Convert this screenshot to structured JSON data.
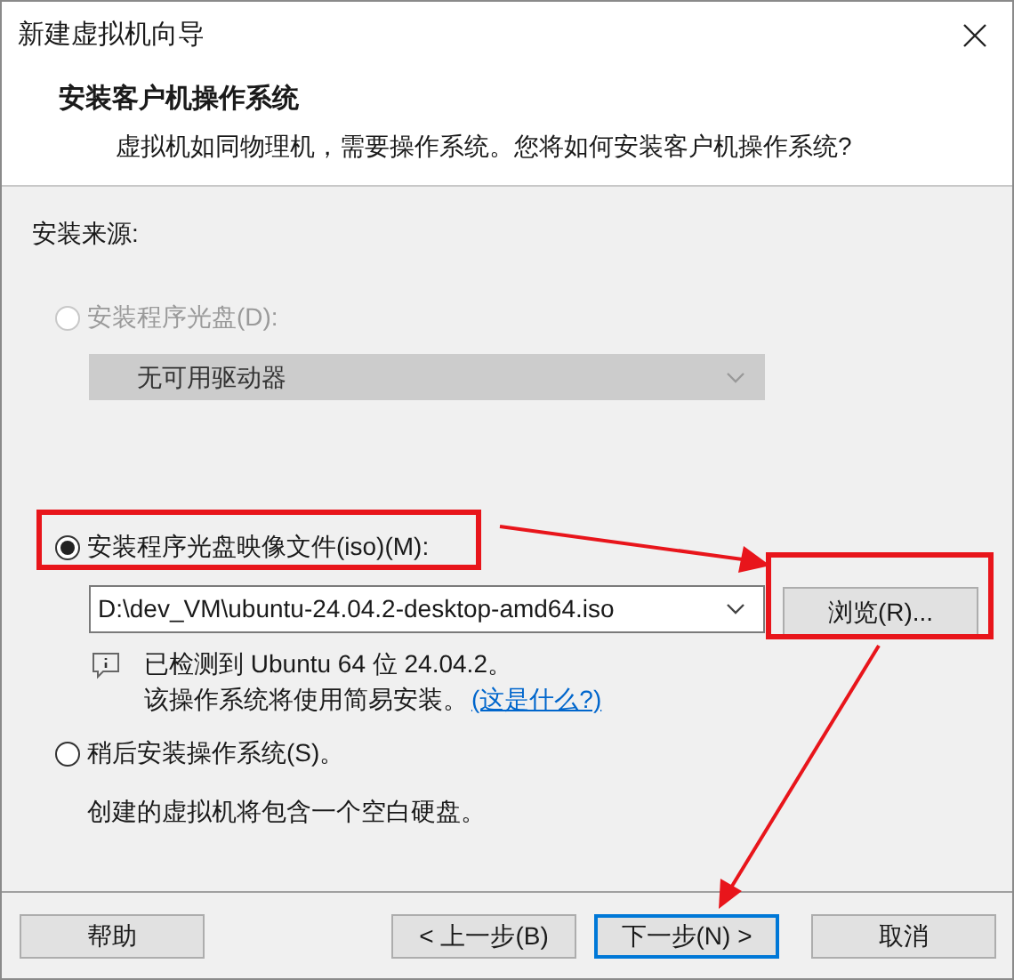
{
  "window": {
    "title": "新建虚拟机向导"
  },
  "header": {
    "title": "安装客户机操作系统",
    "subtitle": "虚拟机如同物理机，需要操作系统。您将如何安装客户机操作系统?"
  },
  "source_label": "安装来源:",
  "options": [
    {
      "kind": "drive",
      "label": "安装程序光盘(D):",
      "selected": false,
      "disabled": true,
      "dropdown": {
        "value": "无可用驱动器",
        "disabled": true
      }
    },
    {
      "kind": "iso",
      "label": "安装程序光盘映像文件(iso)(M):",
      "selected": true,
      "disabled": false,
      "field": {
        "value": "D:\\dev_VM\\ubuntu-24.04.2-desktop-amd64.iso"
      },
      "browse_button": "浏览(R)...",
      "info": {
        "detected": "已检测到 Ubuntu 64 位 24.04.2。",
        "sentence": "该操作系统将使用简易安装。",
        "link": "(这是什么?)"
      }
    },
    {
      "kind": "later",
      "label": "稍后安装操作系统(S)。",
      "selected": false,
      "disabled": false,
      "note": "创建的虚拟机将包含一个空白硬盘。"
    }
  ],
  "buttons": [
    {
      "label": "帮助",
      "default": false
    },
    {
      "label": "< 上一步(B)",
      "default": false
    },
    {
      "label": "下一步(N) >",
      "default": true
    },
    {
      "label": "取消",
      "default": false
    }
  ]
}
